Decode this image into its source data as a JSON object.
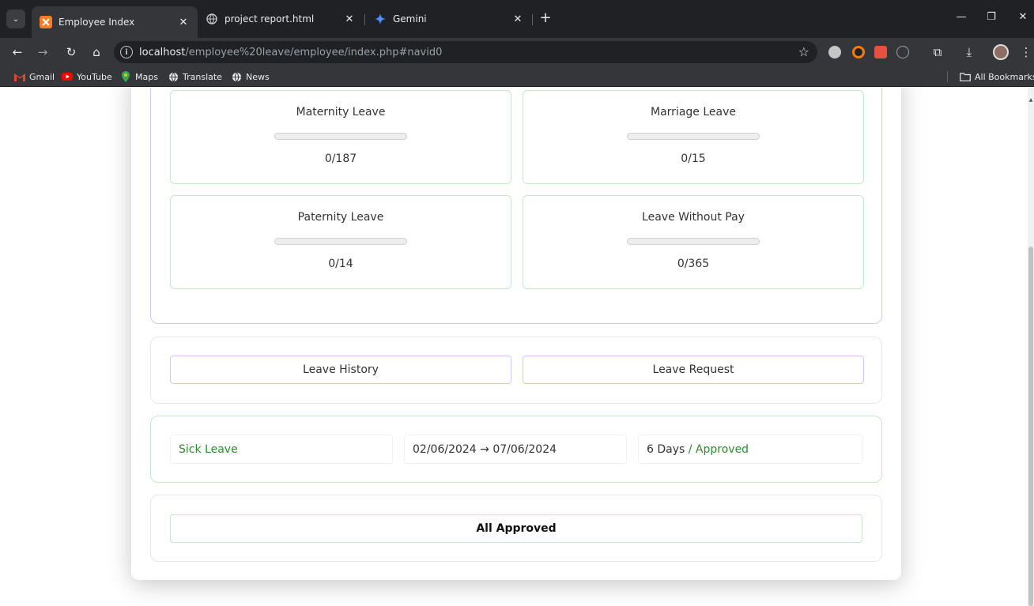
{
  "browser": {
    "tabs": [
      {
        "title": "Employee Index",
        "active": true
      },
      {
        "title": "project report.html",
        "active": false
      },
      {
        "title": "Gemini",
        "active": false
      }
    ],
    "address": {
      "host": "localhost",
      "path": "/employee%20leave/employee/index.php#navid0"
    },
    "bookmarks": [
      "Gmail",
      "YouTube",
      "Maps",
      "Translate",
      "News"
    ],
    "all_bookmarks": "All Bookmarks"
  },
  "leave_balances": [
    {
      "name": "Maternity Leave",
      "used": 0,
      "total": 187,
      "count": "0/187"
    },
    {
      "name": "Marriage Leave",
      "used": 0,
      "total": 15,
      "count": "0/15"
    },
    {
      "name": "Paternity Leave",
      "used": 0,
      "total": 14,
      "count": "0/14"
    },
    {
      "name": "Leave Without Pay",
      "used": 0,
      "total": 365,
      "count": "0/365"
    }
  ],
  "actions": {
    "history": "Leave History",
    "request": "Leave Request"
  },
  "request": {
    "type": "Sick Leave",
    "dates": "02/06/2024 → 07/06/2024",
    "days": "6 Days",
    "status": "/ Approved"
  },
  "summary": {
    "label": "All Approved"
  },
  "colors": {
    "accent_green": "#2e8b2e",
    "border_green": "#c3ecc8",
    "border_purple": "#cfc9f5"
  }
}
